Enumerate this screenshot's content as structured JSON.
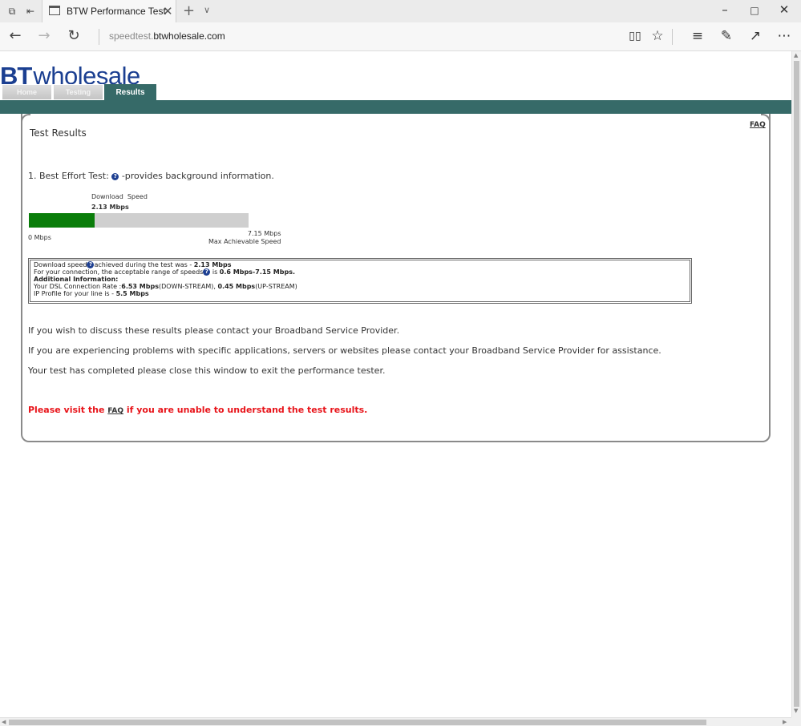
{
  "browser": {
    "tab_title": "BTW Performance Test",
    "url_host_prefix": "speedtest.",
    "url_host_domain": "btwholesale.com",
    "icons": [
      "tab-set-aside-icon",
      "tab-preview-icon",
      "page-icon",
      "close-icon",
      "plus-icon",
      "chevron-down-icon",
      "back-icon",
      "forward-icon",
      "refresh-icon",
      "reading-view-icon",
      "favorite-star-icon",
      "hub-icon",
      "web-note-icon",
      "share-icon",
      "more-icon",
      "minimize-icon",
      "maximize-icon",
      "window-close-icon"
    ]
  },
  "page": {
    "logo_bt": "BT",
    "logo_wholesale": "wholesale",
    "nav": {
      "home": "Home",
      "testing": "Testing",
      "results": "Results"
    },
    "faq_link": "FAQ",
    "title": "Test Results",
    "best_effort": {
      "prefix": "1. Best Effort Test:",
      "suffix": "-provides background information."
    },
    "gauge": {
      "label": "Download  Speed",
      "value_text": "2.13 Mbps",
      "min_label": "0 Mbps",
      "max_value": "7.15 Mbps",
      "max_caption": "Max Achievable Speed",
      "value": 2.13,
      "max": 7.15,
      "fill_color": "#0a7d0a",
      "track_color": "#cfcfcf"
    },
    "info": {
      "line1_pre": "Download speed",
      "line1_mid": "achieved during the test was - ",
      "line1_val": "2.13 Mbps",
      "line2_pre": "For your connection, the acceptable range of speeds",
      "line2_mid": " is ",
      "line2_val": "0.6 Mbps-7.15 Mbps.",
      "line3": "Additional Information:",
      "line4_pre": "Your DSL Connection Rate :",
      "line4_down": "6.53 Mbps",
      "line4_down_lbl": "(DOWN-STREAM), ",
      "line4_up": "0.45 Mbps",
      "line4_up_lbl": "(UP-STREAM)",
      "line5_pre": "IP Profile for your line is - ",
      "line5_val": "5.5 Mbps"
    },
    "para1": "If you wish to discuss these results please contact your Broadband Service Provider.",
    "para2": "If you are experiencing problems with specific applications, servers or websites please contact your Broadband Service Provider for assistance.",
    "para3": "Your test has completed please close this window to exit the performance tester.",
    "red_note": {
      "pre": "Please visit the ",
      "link": "FAQ",
      "post": " if you are unable to understand the test results."
    },
    "colors": {
      "brand_blue": "#1b3f91",
      "teal": "#366a68",
      "alert_red": "#e8141a"
    }
  }
}
